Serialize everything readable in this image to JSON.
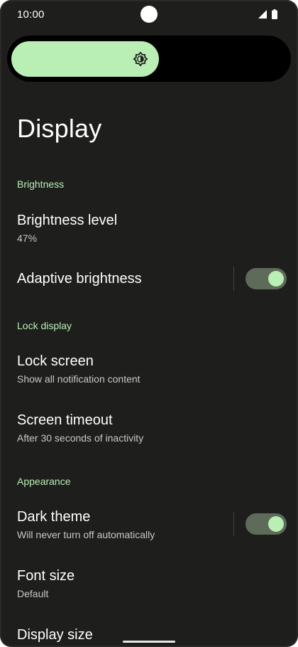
{
  "status_bar": {
    "time": "10:00",
    "icons": [
      "camera-cutout",
      "signal-icon",
      "battery-icon"
    ]
  },
  "brightness_slider": {
    "level": 0.47,
    "icon": "brightness-icon"
  },
  "page": {
    "title": "Display"
  },
  "sections": {
    "brightness": {
      "header": "Brightness",
      "brightness_level": {
        "title": "Brightness level",
        "summary": "47%"
      },
      "adaptive_brightness": {
        "title": "Adaptive brightness",
        "enabled": true
      }
    },
    "lock_display": {
      "header": "Lock display",
      "lock_screen": {
        "title": "Lock screen",
        "summary": "Show all notification content"
      },
      "screen_timeout": {
        "title": "Screen timeout",
        "summary": "After 30 seconds of inactivity"
      }
    },
    "appearance": {
      "header": "Appearance",
      "dark_theme": {
        "title": "Dark theme",
        "summary": "Will never turn off automatically",
        "enabled": true
      },
      "font_size": {
        "title": "Font size",
        "summary": "Default"
      },
      "display_size": {
        "title": "Display size"
      }
    }
  },
  "colors": {
    "background": "#1e1f1c",
    "accent": "#b9eeb5",
    "switch_track": "#5e6b5a",
    "text_primary": "#ffffff",
    "text_secondary": "#c8c8c3"
  }
}
